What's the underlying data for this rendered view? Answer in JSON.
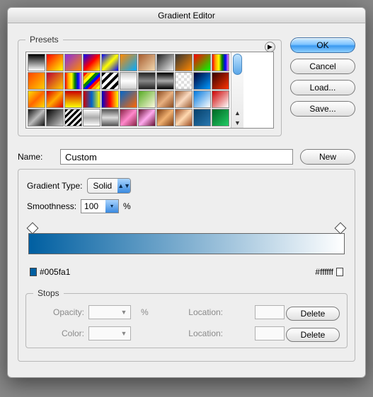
{
  "title": "Gradient Editor",
  "buttons": {
    "ok": "OK",
    "cancel": "Cancel",
    "load": "Load...",
    "save": "Save...",
    "new": "New",
    "delete": "Delete"
  },
  "presets": {
    "legend": "Presets"
  },
  "name": {
    "label": "Name:",
    "value": "Custom"
  },
  "gradient": {
    "typeLabel": "Gradient Type:",
    "typeValue": "Solid",
    "smoothLabel": "Smoothness:",
    "smoothValue": "100",
    "smoothUnit": "%",
    "leftColor": "#005fa1",
    "rightColor": "#ffffff"
  },
  "stops": {
    "legend": "Stops",
    "opacityLabel": "Opacity:",
    "opacityValue": "",
    "unit": "%",
    "locationLabel": "Location:",
    "opacityLoc": "",
    "colorLabel": "Color:",
    "colorLoc": ""
  }
}
